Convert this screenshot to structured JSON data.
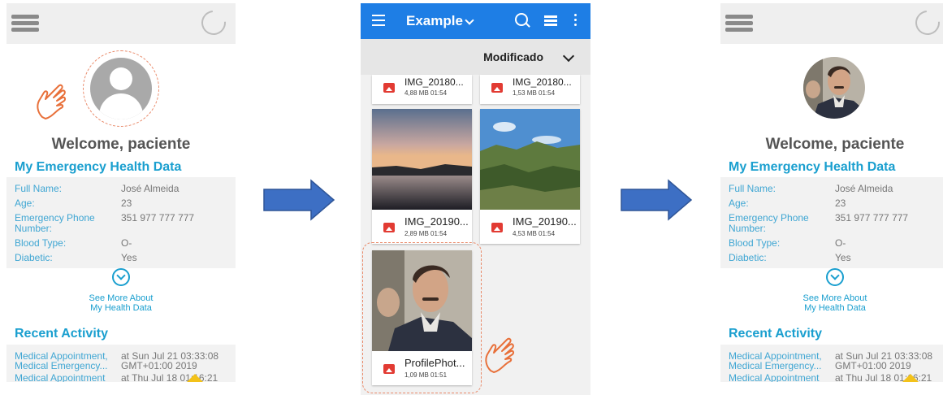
{
  "screens": {
    "before": {
      "welcome": "Welcome, paciente",
      "health_title": "My Emergency Health Data",
      "fields": [
        {
          "label": "Full Name:",
          "value": "José Almeida"
        },
        {
          "label": "Age:",
          "value": "23"
        },
        {
          "label": "Emergency Phone Number:",
          "value": "351 977 777 777"
        },
        {
          "label": "Blood Type:",
          "value": "O-"
        },
        {
          "label": "Diabetic:",
          "value": "Yes"
        }
      ],
      "see_more_line1": "See More About",
      "see_more_line2": "My Health Data",
      "activity_title": "Recent Activity",
      "activity": [
        {
          "label": "Medical Appointment,",
          "value": "at Sun Jul 21 03:33:08"
        },
        {
          "label": "Medical Emergency...",
          "value": "GMT+01:00 2019"
        },
        {
          "label": "Medical Appointment",
          "value": "at Thu Jul 18 01:16:21"
        }
      ]
    },
    "after": {
      "welcome": "Welcome, paciente",
      "health_title": "My Emergency Health Data",
      "fields": [
        {
          "label": "Full Name:",
          "value": "José Almeida"
        },
        {
          "label": "Age:",
          "value": "23"
        },
        {
          "label": "Emergency Phone Number:",
          "value": "351 977 777 777"
        },
        {
          "label": "Blood Type:",
          "value": "O-"
        },
        {
          "label": "Diabetic:",
          "value": "Yes"
        }
      ],
      "see_more_line1": "See More About",
      "see_more_line2": "My Health Data",
      "activity_title": "Recent Activity",
      "activity": [
        {
          "label": "Medical Appointment,",
          "value": "at Sun Jul 21 03:33:08"
        },
        {
          "label": "Medical Emergency...",
          "value": "GMT+01:00 2019"
        },
        {
          "label": "Medical Appointment",
          "value": "at Thu Jul 18 01:16:21"
        }
      ]
    }
  },
  "picker": {
    "title": "Example",
    "sort_label": "Modificado",
    "files": [
      {
        "name": "IMG_20180...",
        "meta": "4,88 MB 01:54"
      },
      {
        "name": "IMG_20180...",
        "meta": "1,53 MB 01:54"
      },
      {
        "name": "IMG_20190...",
        "meta": "2,89 MB 01:54"
      },
      {
        "name": "IMG_20190...",
        "meta": "4,53 MB 01:54"
      },
      {
        "name": "ProfilePhot...",
        "meta": "1,09 MB 01:51"
      }
    ]
  },
  "colors": {
    "accent": "#1a9fcf",
    "appbar": "#1e7ee5",
    "arrow": "#3d6fc4",
    "highlight_dashed": "#e98a6a",
    "hand": "#e8703a",
    "file_icon": "#e23b33"
  },
  "icons": [
    "menu-icon",
    "loading-spinner-icon",
    "pointing-hand-icon",
    "chevron-down-circle-icon",
    "search-icon",
    "list-view-icon",
    "more-vert-icon",
    "image-file-icon"
  ]
}
